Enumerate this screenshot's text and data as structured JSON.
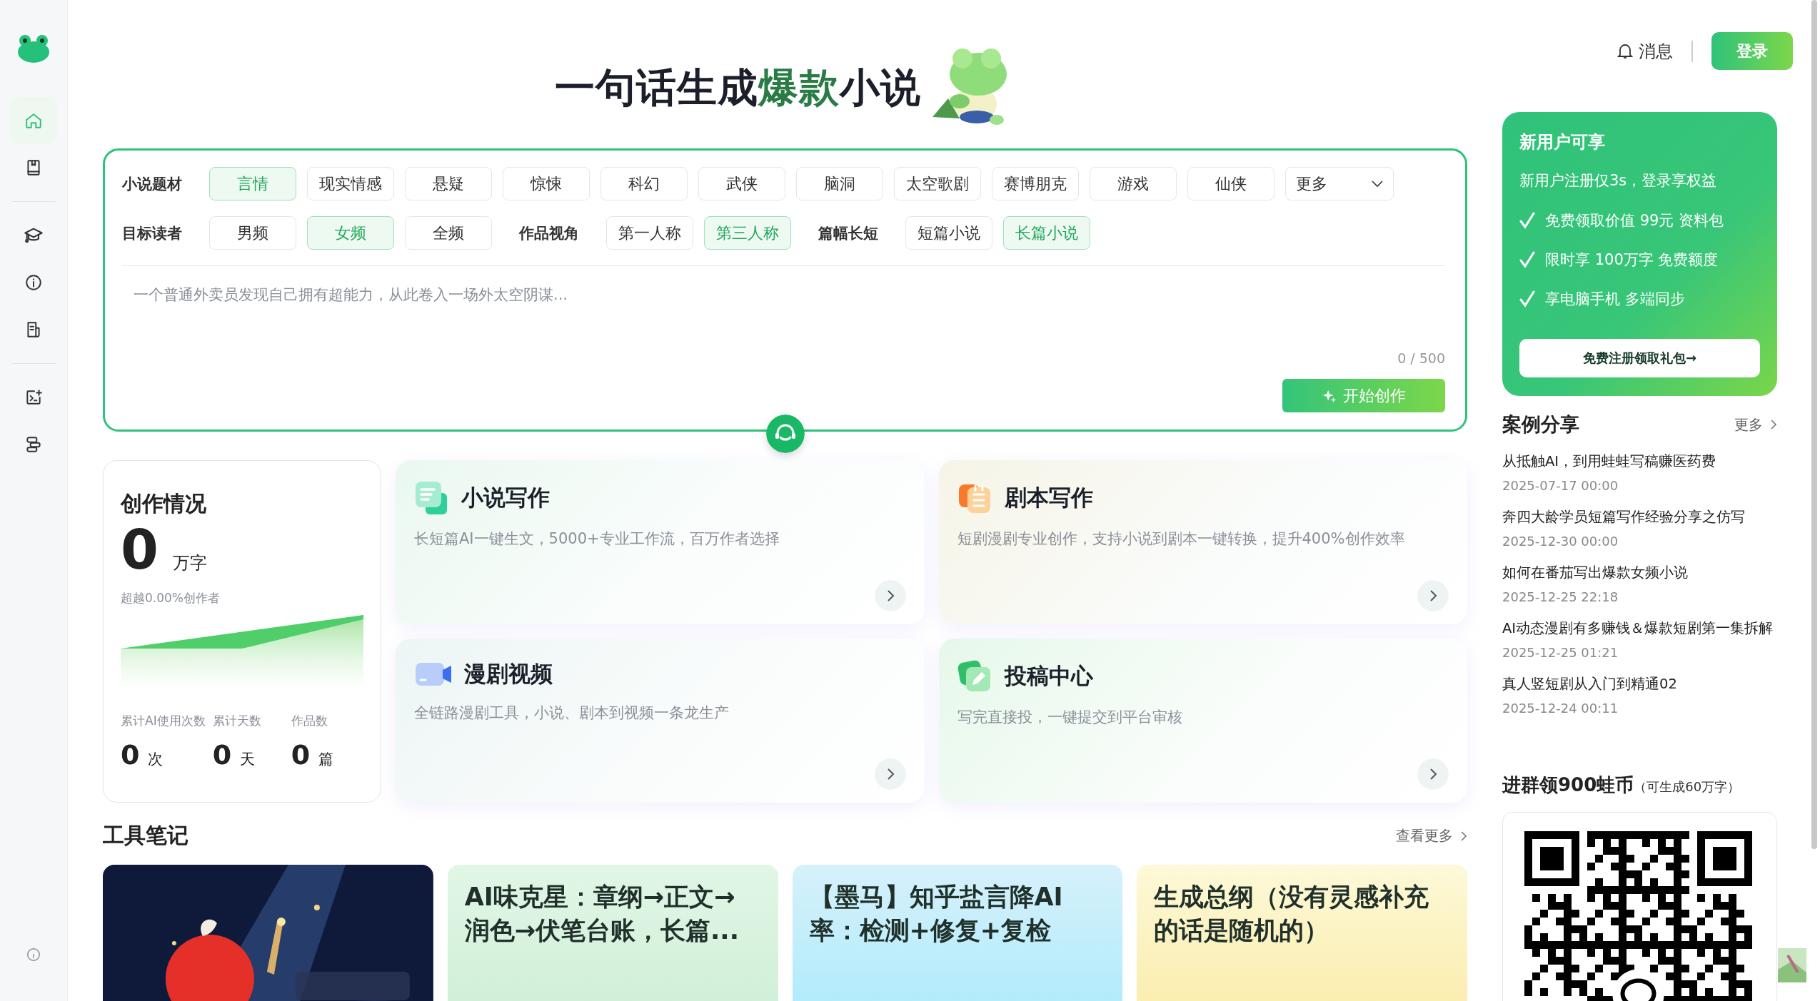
{
  "sidebar": {
    "items": [
      {
        "kind": "home",
        "selected": true
      },
      {
        "kind": "book",
        "selected": false
      },
      {
        "kind": "divider"
      },
      {
        "kind": "cap",
        "selected": false
      },
      {
        "kind": "info",
        "selected": false
      },
      {
        "kind": "doc",
        "selected": false
      },
      {
        "kind": "divider"
      },
      {
        "kind": "terminal",
        "selected": false
      },
      {
        "kind": "layout",
        "selected": false
      }
    ]
  },
  "header": {
    "title_before": "一句话生成",
    "title_highlight": "爆款",
    "title_after": "小说",
    "messages": "消息",
    "login": "登录"
  },
  "filters": [
    {
      "groups": [
        {
          "label": "小说题材",
          "options": [
            {
              "text": "言情",
              "selected": true
            },
            {
              "text": "现实情感",
              "selected": false
            },
            {
              "text": "悬疑",
              "selected": false
            },
            {
              "text": "惊悚",
              "selected": false
            },
            {
              "text": "科幻",
              "selected": false
            },
            {
              "text": "武侠",
              "selected": false
            },
            {
              "text": "脑洞",
              "selected": false
            },
            {
              "text": "太空歌剧",
              "selected": false
            },
            {
              "text": "赛博朋克",
              "selected": false
            },
            {
              "text": "游戏",
              "selected": false
            },
            {
              "text": "仙侠",
              "selected": false
            }
          ],
          "dropdown": "更多"
        }
      ]
    },
    {
      "groups": [
        {
          "label": "目标读者",
          "options": [
            {
              "text": "男频",
              "selected": false
            },
            {
              "text": "女频",
              "selected": true
            },
            {
              "text": "全频",
              "selected": false
            }
          ]
        },
        {
          "label": "作品视角",
          "options": [
            {
              "text": "第一人称",
              "selected": false
            },
            {
              "text": "第三人称",
              "selected": true
            }
          ]
        },
        {
          "label": "篇幅长短",
          "options": [
            {
              "text": "短篇小说",
              "selected": false
            },
            {
              "text": "长篇小说",
              "selected": true
            }
          ]
        }
      ]
    }
  ],
  "prompt": {
    "placeholder": "一个普通外卖员发现自己拥有超能力，从此卷入一场外太空阴谋...",
    "counter": "0 / 500",
    "button": "开始创作"
  },
  "stats": {
    "title": "创作情况",
    "value": "0",
    "unit": "万字",
    "note": "超越0.00%创作者",
    "metrics": [
      {
        "label": "累计AI使用次数",
        "value": "0",
        "unit": "次"
      },
      {
        "label": "累计天数",
        "value": "0",
        "unit": "天"
      },
      {
        "label": "作品数",
        "value": "0",
        "unit": "篇"
      }
    ]
  },
  "features": [
    {
      "kind": "novel",
      "title": "小说写作",
      "desc": "长短篇AI一键生文，5000+专业工作流，百万作者选择"
    },
    {
      "kind": "script",
      "title": "剧本写作",
      "desc": "短剧漫剧专业创作，支持小说到剧本一键转换，提升400%创作效率"
    },
    {
      "kind": "video",
      "title": "漫剧视频",
      "desc": "全链路漫剧工具，小说、剧本到视频一条龙生产"
    },
    {
      "kind": "submit",
      "title": "投稿中心",
      "desc": "写完直接投，一键提交到平台审核"
    }
  ],
  "notes": {
    "title": "工具笔记",
    "more": "查看更多",
    "cards": [
      {
        "kind": "picture"
      },
      {
        "kind": "green",
        "title": "AI味克星：章纲→正文→润色→伏笔台账，长篇..."
      },
      {
        "kind": "blue",
        "title": "【墨马】知乎盐言降AI率：检测+修复+复检"
      },
      {
        "kind": "yellow",
        "title": "生成总纲（没有灵感补充的话是随机的）"
      }
    ]
  },
  "promo": {
    "title": "新用户可享",
    "subtitle": "新用户注册仅3s，登录享权益",
    "perks": [
      "免费领取价值 99元 资料包",
      "限时享 100万字 免费额度",
      "享电脑手机 多端同步"
    ],
    "button": "免费注册领取礼包→"
  },
  "cases": {
    "title": "案例分享",
    "more": "更多",
    "items": [
      {
        "title": "从抵触AI，到用蛙蛙写稿赚医药费",
        "date": "2025-07-17 00:00"
      },
      {
        "title": "奔四大龄学员短篇写作经验分享之仿写",
        "date": "2025-12-30 00:00"
      },
      {
        "title": "如何在番茄写出爆款女频小说",
        "date": "2025-12-25 22:18"
      },
      {
        "title": "AI动态漫剧有多赚钱＆爆款短剧第一集拆解",
        "date": "2025-12-25 01:21"
      },
      {
        "title": "真人竖短剧从入门到精通02",
        "date": "2025-12-24 00:11"
      }
    ]
  },
  "group": {
    "title": "进群领900蛙币",
    "note": "（可生成60万字）"
  }
}
